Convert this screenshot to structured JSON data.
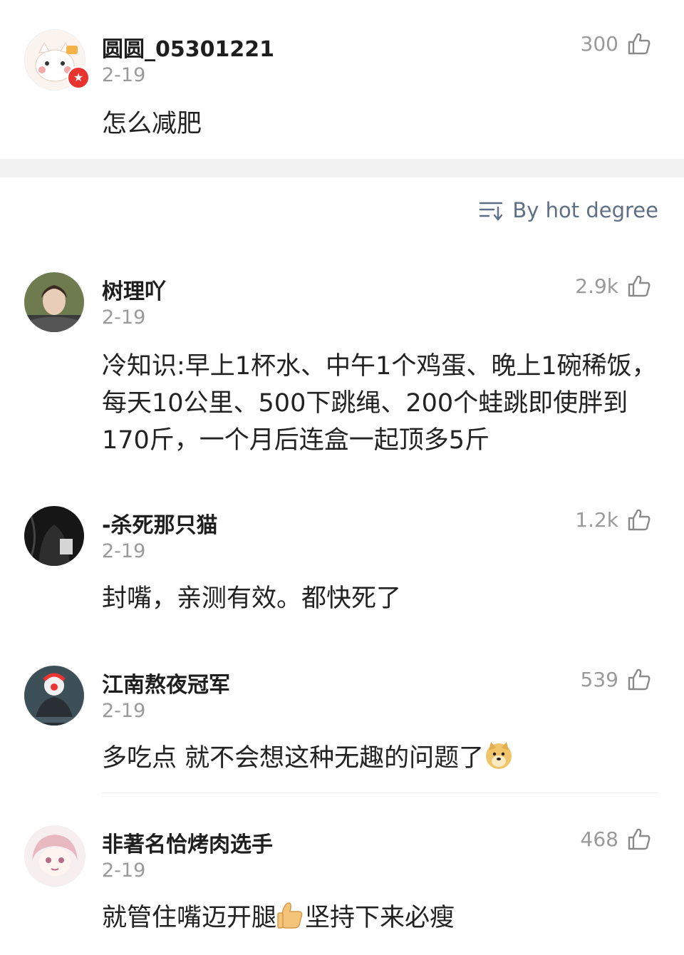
{
  "comments": [
    {
      "username": "圆圆_05301221",
      "date": "2-19",
      "likes": "300",
      "text": "怎么减肥"
    },
    {
      "username": "树理吖",
      "date": "2-19",
      "likes": "2.9k",
      "text": "冷知识:早上1杯水、中午1个鸡蛋、晚上1碗稀饭，每天10公里、500下跳绳、200个蛙跳即使胖到170斤，一个月后连盒一起顶多5斤"
    },
    {
      "username": "-杀死那只猫",
      "date": "2-19",
      "likes": "1.2k",
      "text": "封嘴，亲测有效。都快死了"
    },
    {
      "username": "江南熬夜冠军",
      "date": "2-19",
      "likes": "539",
      "text": "多吃点 就不会想这种无趣的问题了",
      "emoji": "doge-emoji"
    },
    {
      "username": "非著名恰烤肉选手",
      "date": "2-19",
      "likes": "468",
      "text_before": "就管住嘴迈开腿",
      "emoji": "thumbs-up-emoji",
      "text_after": "坚持下来必瘦"
    }
  ],
  "sort": {
    "label": "By hot degree",
    "icon": "sort-icon"
  },
  "colors": {
    "accent": "#5f6f86",
    "muted": "#9a9a9a",
    "divider": "#f2f2f2"
  }
}
